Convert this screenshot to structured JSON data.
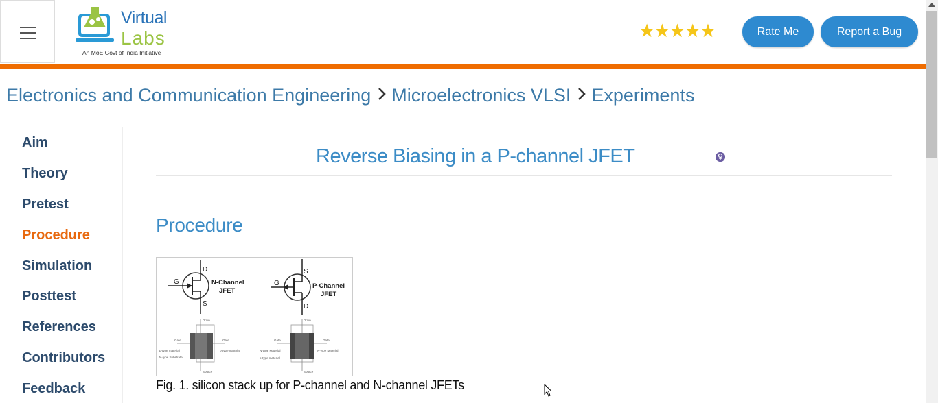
{
  "header": {
    "logo_text_line1": "Virtual",
    "logo_text_line2": "Labs",
    "logo_tagline": "An MoE Govt of India Initiative",
    "rating_stars": "★★★★★",
    "rate_button": "Rate Me",
    "report_button": "Report a Bug",
    "colors": {
      "accent_bar": "#ef6c00",
      "button": "#2e8ad0",
      "stars": "#f5c518"
    }
  },
  "breadcrumb": {
    "items": [
      "Electronics and Communication Engineering",
      "Microelectronics VLSI",
      "Experiments"
    ],
    "separator_icon": "chevron-right-icon"
  },
  "sidebar": {
    "items": [
      {
        "label": "Aim"
      },
      {
        "label": "Theory"
      },
      {
        "label": "Pretest"
      },
      {
        "label": "Procedure",
        "active": true
      },
      {
        "label": "Simulation"
      },
      {
        "label": "Posttest"
      },
      {
        "label": "References"
      },
      {
        "label": "Contributors"
      },
      {
        "label": "Feedback"
      }
    ]
  },
  "main": {
    "experiment_title": "Reverse Biasing in a P-channel JFET",
    "section_title": "Procedure",
    "figure": {
      "n_label_line1": "N-Channel",
      "n_label_line2": "JFET",
      "p_label_line1": "P-Channel",
      "p_label_line2": "JFET",
      "pin_g": "G",
      "pin_d": "D",
      "pin_s": "S",
      "n_layers": {
        "drain": "Drain",
        "gate": "Gate",
        "ptype": "p-type material",
        "ntype": "N-type Substrate",
        "source": "Source"
      },
      "p_layers": {
        "drain": "Drain",
        "gate": "Gate",
        "ntype": "N-type Material",
        "ptype": "p-type material",
        "source": "Source"
      }
    },
    "caption": "Fig. 1. silicon stack up for P-channel and N-channel JFETs"
  }
}
